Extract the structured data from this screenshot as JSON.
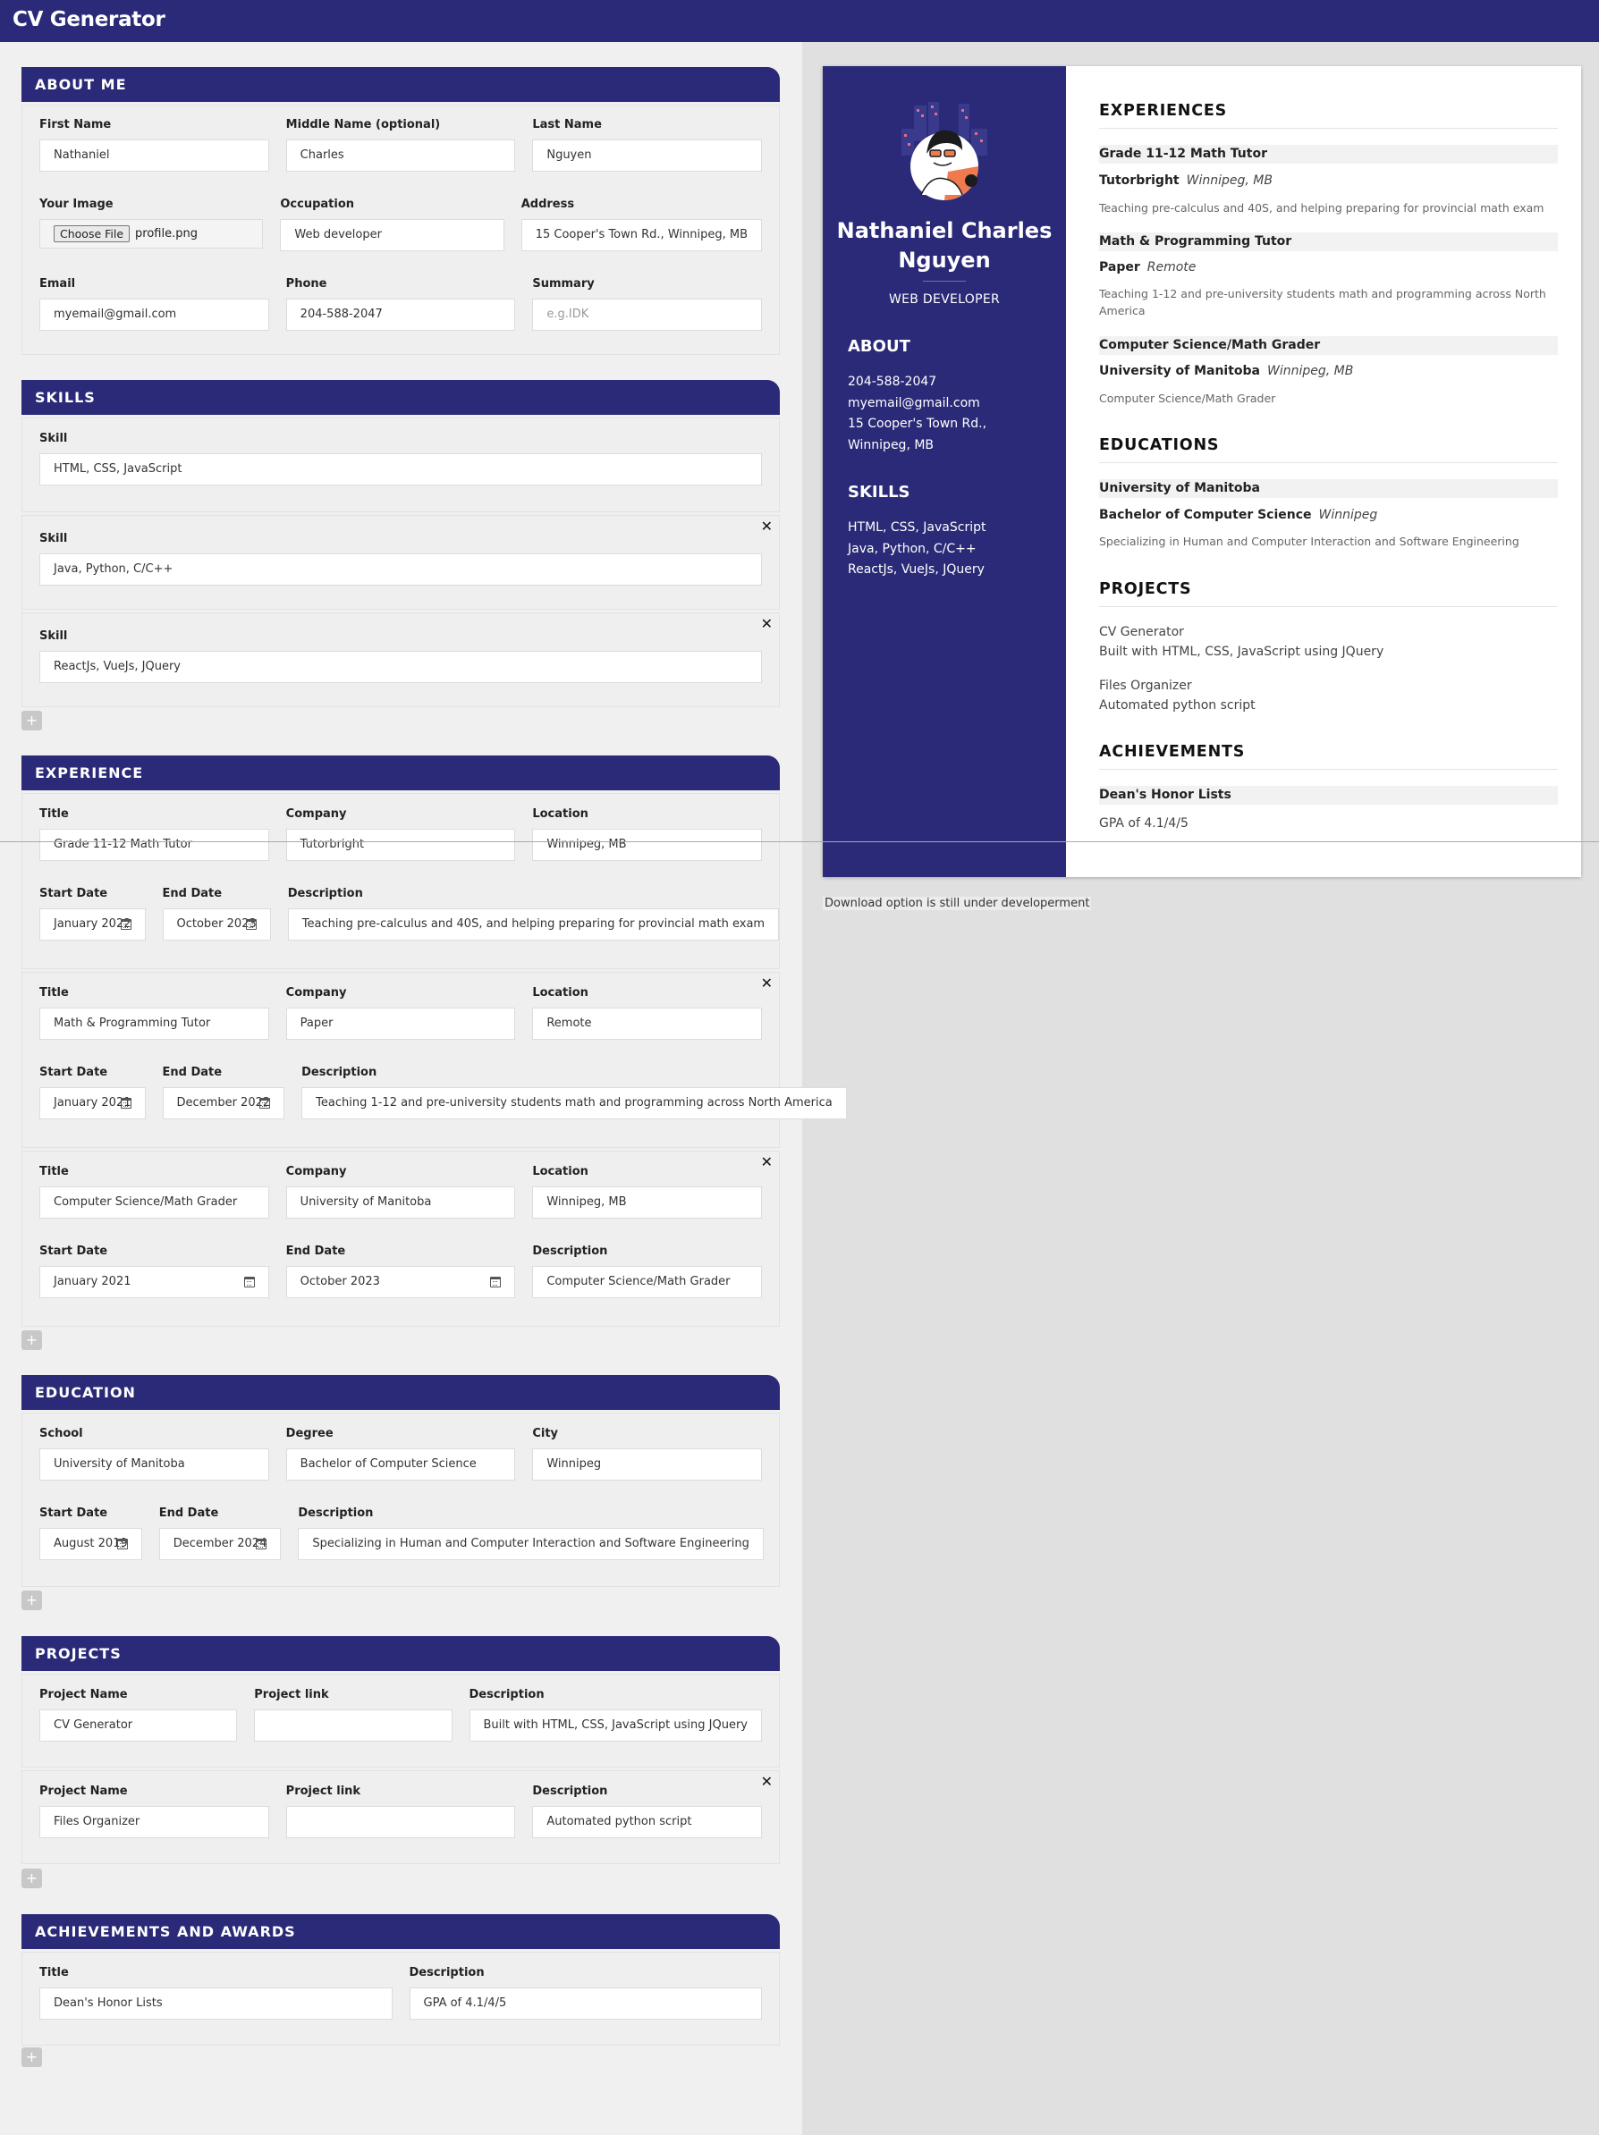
{
  "app": {
    "title": "CV Generator"
  },
  "about": {
    "heading": "ABOUT ME",
    "first_name_label": "First Name",
    "first_name": "Nathaniel",
    "middle_name_label": "Middle Name (optional)",
    "middle_name": "Charles",
    "last_name_label": "Last Name",
    "last_name": "Nguyen",
    "image_label": "Your Image",
    "choose_file": "Choose File",
    "file_name": "profile.png",
    "occupation_label": "Occupation",
    "occupation": "Web developer",
    "address_label": "Address",
    "address": "15 Cooper's Town Rd., Winnipeg, MB",
    "email_label": "Email",
    "email": "myemail@gmail.com",
    "phone_label": "Phone",
    "phone": "204-588-2047",
    "summary_label": "Summary",
    "summary_placeholder": "e.g.IDK"
  },
  "skills": {
    "heading": "SKILLS",
    "label": "Skill",
    "items": [
      "HTML, CSS, JavaScript",
      "Java, Python, C/C++",
      "ReactJs, VueJs, JQuery"
    ]
  },
  "experience": {
    "heading": "EXPERIENCE",
    "title_label": "Title",
    "company_label": "Company",
    "location_label": "Location",
    "start_label": "Start Date",
    "end_label": "End Date",
    "desc_label": "Description",
    "items": [
      {
        "title": "Grade 11-12 Math Tutor",
        "company": "Tutorbright",
        "location": "Winnipeg, MB",
        "start": "January  2022",
        "end": "October  2023",
        "desc": "Teaching pre-calculus and 40S, and helping preparing for provincial math exam"
      },
      {
        "title": "Math & Programming Tutor",
        "company": "Paper",
        "location": "Remote",
        "start": "January  2021",
        "end": "December  2022",
        "desc": "Teaching 1-12 and pre-university students math and programming across North America"
      },
      {
        "title": "Computer Science/Math Grader",
        "company": "University of Manitoba",
        "location": "Winnipeg, MB",
        "start": "January  2021",
        "end": "October  2023",
        "desc": "Computer Science/Math Grader"
      }
    ]
  },
  "education": {
    "heading": "EDUCATION",
    "school_label": "School",
    "degree_label": "Degree",
    "city_label": "City",
    "start_label": "Start Date",
    "end_label": "End Date",
    "desc_label": "Description",
    "school": "University of Manitoba",
    "degree": "Bachelor of Computer Science",
    "city": "Winnipeg",
    "start": "August  2019",
    "end": "December  2024",
    "desc": "Specializing in Human and Computer Interaction and Software Engineering"
  },
  "projects": {
    "heading": "PROJECTS",
    "name_label": "Project Name",
    "link_label": "Project link",
    "desc_label": "Description",
    "items": [
      {
        "name": "CV Generator",
        "link": "",
        "desc": "Built with HTML, CSS, JavaScript using JQuery"
      },
      {
        "name": "Files Organizer",
        "link": "",
        "desc": "Automated python script"
      }
    ]
  },
  "achievements": {
    "heading": "ACHIEVEMENTS AND AWARDS",
    "title_label": "Title",
    "desc_label": "Description",
    "title": "Dean's Honor Lists",
    "desc": "GPA of 4.1/4/5"
  },
  "add_label": "+",
  "close_label": "✕",
  "preview": {
    "name_line1": "Nathaniel Charles",
    "name_line2": "Nguyen",
    "occupation": "WEB DEVELOPER",
    "about_heading": "ABOUT",
    "about_lines": [
      "204-588-2047",
      "myemail@gmail.com",
      "15 Cooper's Town Rd.,",
      "Winnipeg, MB"
    ],
    "skills_heading": "SKILLS",
    "skills_lines": [
      "HTML, CSS, JavaScript",
      "Java, Python, C/C++",
      "ReactJs, VueJs, JQuery"
    ],
    "experiences_heading": "EXPERIENCES",
    "exp": [
      {
        "title": "Grade 11-12 Math Tutor",
        "company": "Tutorbright",
        "location": "Winnipeg, MB",
        "desc": "Teaching pre-calculus and 40S, and helping preparing for provincial math exam"
      },
      {
        "title": "Math & Programming Tutor",
        "company": "Paper",
        "location": "Remote",
        "desc": "Teaching 1-12 and pre-university students math and programming across North America"
      },
      {
        "title": "Computer Science/Math Grader",
        "company": "University of Manitoba",
        "location": "Winnipeg, MB",
        "desc": "Computer Science/Math Grader"
      }
    ],
    "educations_heading": "EDUCATIONS",
    "edu": {
      "school": "University of Manitoba",
      "degree": "Bachelor of Computer Science",
      "city": "Winnipeg",
      "desc": "Specializing in Human and Computer Interaction and Software Engineering"
    },
    "projects_heading": "PROJECTS",
    "proj": [
      {
        "name": "CV Generator",
        "desc": "Built with HTML, CSS, JavaScript using JQuery"
      },
      {
        "name": "Files Organizer",
        "desc": "Automated python script"
      }
    ],
    "achievements_heading": "ACHIEVEMENTS",
    "ach": {
      "title": "Dean's Honor Lists",
      "desc": "GPA of 4.1/4/5"
    }
  },
  "download_note": "Download option is still under developerment",
  "colors": {
    "primary": "#2a2a78",
    "panel": "#f0f0f0",
    "canvas": "#e0e0e0"
  }
}
